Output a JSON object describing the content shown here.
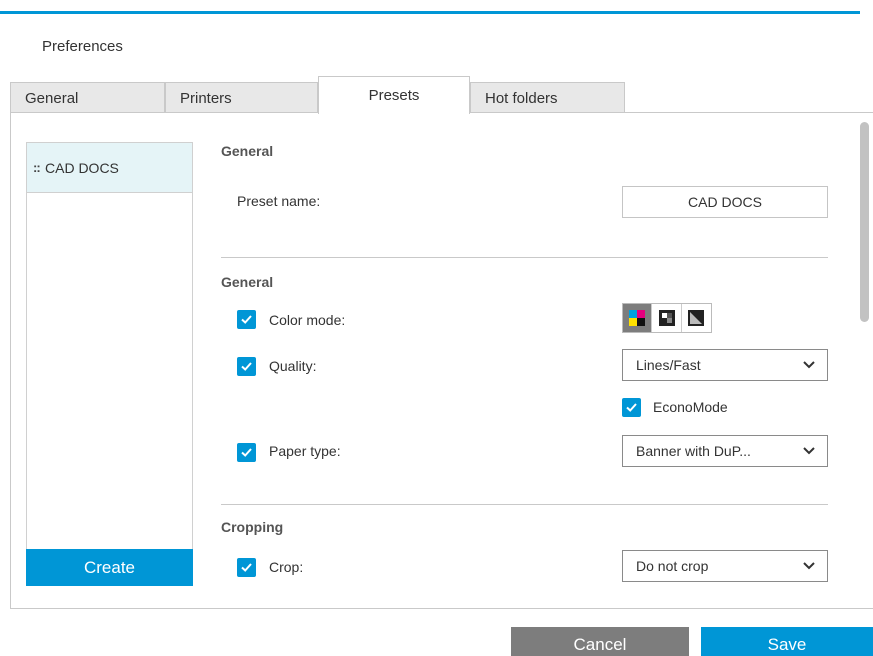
{
  "dialog": {
    "title": "Preferences"
  },
  "tabs": [
    {
      "label": "General",
      "active": false
    },
    {
      "label": "Printers",
      "active": false
    },
    {
      "label": "Presets",
      "active": true
    },
    {
      "label": "Hot folders",
      "active": false
    }
  ],
  "presets": {
    "items": [
      {
        "label": "CAD DOCS"
      }
    ],
    "create_label": "Create"
  },
  "sections": {
    "general_1": {
      "title": "General",
      "preset_name_label": "Preset name:",
      "preset_name_value": "CAD DOCS"
    },
    "general_2": {
      "title": "General",
      "color_mode": {
        "label": "Color mode:",
        "checked": true,
        "options": [
          "color-icon",
          "grayscale-icon",
          "bw-icon"
        ],
        "selected": "color-icon"
      },
      "quality": {
        "label": "Quality:",
        "checked": true,
        "value": "Lines/Fast"
      },
      "econo_mode": {
        "label": "EconoMode",
        "checked": true
      },
      "paper_type": {
        "label": "Paper type:",
        "checked": true,
        "value": "Banner with DuP..."
      }
    },
    "cropping": {
      "title": "Cropping",
      "crop": {
        "label": "Crop:",
        "checked": true,
        "value": "Do not crop"
      }
    }
  },
  "footer": {
    "cancel_label": "Cancel",
    "save_label": "Save"
  },
  "colors": {
    "accent": "#0096d6",
    "secondary": "#7d7d7d"
  }
}
